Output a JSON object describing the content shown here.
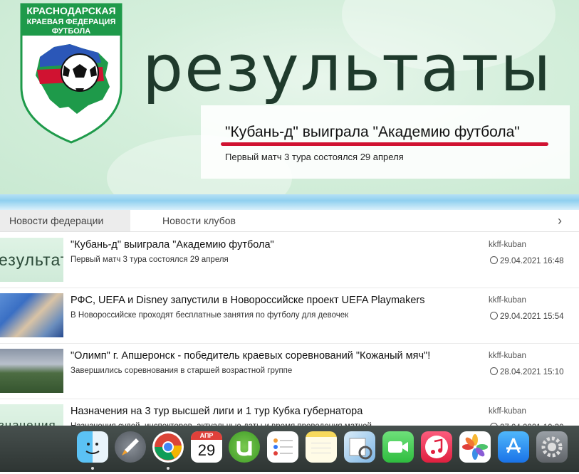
{
  "hero": {
    "logo_lines": [
      "КРАСНОДАРСКАЯ",
      "КРАЕВАЯ ФЕДЕРАЦИЯ",
      "ФУТБОЛА"
    ],
    "title": "Результаты",
    "card_title": "\"Кубань-д\" выиграла \"Академию футбола\"",
    "card_subtitle": "Первый матч 3 тура состоялся 29 апреля"
  },
  "tabs": [
    {
      "label": "Новости федерации",
      "active": true
    },
    {
      "label": "Новости клубов",
      "active": false
    }
  ],
  "tabs_arrow": "›",
  "news": [
    {
      "title": "\"Кубань-д\" выиграла \"Академию футбола\"",
      "subtitle": "Первый матч 3 тура состоялся 29 апреля",
      "author": "kkff-kuban",
      "date": "29.04.2021 16:48",
      "thumb_text": "езультаты"
    },
    {
      "title": "РФС, UEFA и Disney запустили в Новороссийске проект UEFA Playmakers",
      "subtitle": "В Новороссийске проходят бесплатные занятия по футболу для девочек",
      "author": "kkff-kuban",
      "date": "29.04.2021 15:54",
      "thumb_text": ""
    },
    {
      "title": "\"Олимп\" г. Апшеронск - победитель краевых соревнований \"Кожаный мяч\"!",
      "subtitle": "Завершились соревнования в старшей возрастной группе",
      "author": "kkff-kuban",
      "date": "28.04.2021 15:10",
      "thumb_text": ""
    },
    {
      "title": "Назначения на 3 тур высшей лиги и 1 тур Кубка губернатора",
      "subtitle": "Назначения судей, инспекторов, актуальные даты и время проведения матчей",
      "author": "kkff-kuban",
      "date": "27.04.2021 10:30",
      "thumb_text": "значения"
    }
  ],
  "dock": {
    "calendar_month": "АПР",
    "calendar_day": "29",
    "apps": [
      "Finder",
      "Launchpad",
      "Chrome",
      "Calendar",
      "uTorrent",
      "Reminders",
      "Notes",
      "Preview",
      "FaceTime",
      "Music",
      "Photos",
      "App Store",
      "System Preferences"
    ]
  },
  "colors": {
    "accent_red": "#d01231",
    "hero_text": "#1f3a2c",
    "logo_green": "#1e9a4a"
  }
}
